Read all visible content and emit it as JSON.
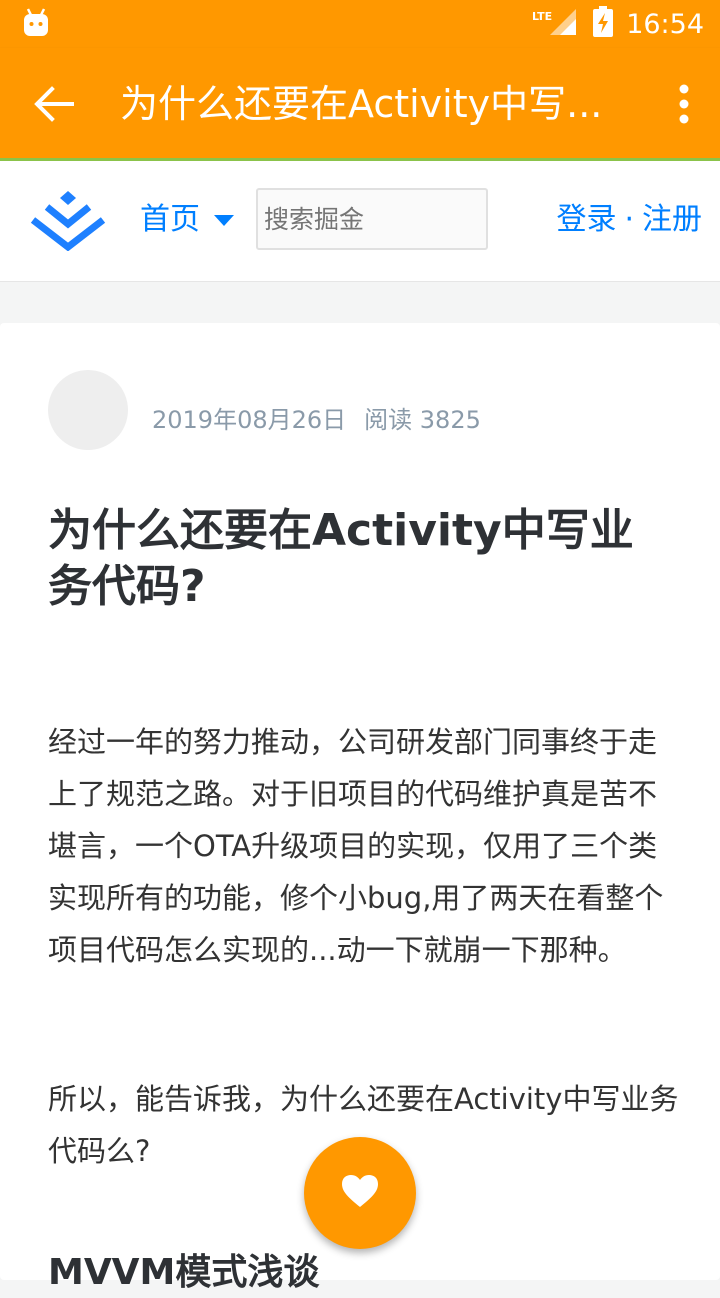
{
  "status_bar": {
    "network": "LTE",
    "time": "16:54"
  },
  "app_bar": {
    "title": "为什么还要在Activity中写..."
  },
  "site_header": {
    "nav_home": "首页",
    "search_placeholder": "搜索掘金",
    "login": "登录",
    "separator": "·",
    "register": "注册"
  },
  "article": {
    "date": "2019年08月26日",
    "reads": "阅读 3825",
    "title": "为什么还要在Activity中写业务代码?",
    "paragraphs": [
      "经过一年的努力推动，公司研发部门同事终于走上了规范之路。对于旧项目的代码维护真是苦不堪言，一个OTA升级项目的实现，仅用了三个类实现所有的功能，修个小bug,用了两天在看整个项目代码怎么实现的...动一下就崩一下那种。",
      "所以，能告诉我，为什么还要在Activity中写业务代码么?"
    ],
    "section_heading": "MVVM模式浅谈"
  },
  "colors": {
    "primary": "#ff9800",
    "link": "#007fff",
    "accent_line": "#8bc34a"
  },
  "icons": [
    "android-icon",
    "signal-icon",
    "battery-charging-icon",
    "back-arrow-icon",
    "more-vert-icon",
    "juejin-logo-icon",
    "heart-icon"
  ]
}
